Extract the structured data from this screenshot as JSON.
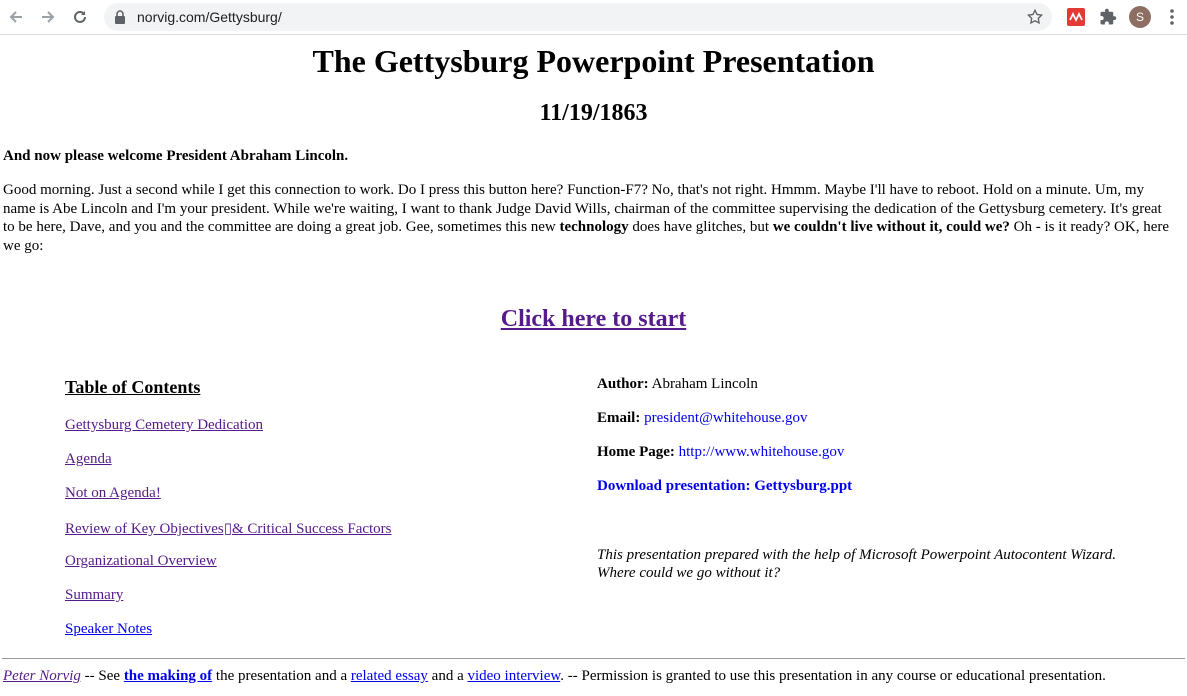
{
  "browser": {
    "url": "norvig.com/Gettysburg/",
    "avatar_letter": "S",
    "colors": {
      "omnibox_bg": "#f1f3f4",
      "ext_icon": "#e53935",
      "avatar": "#8d6e63"
    },
    "icons": [
      "back-icon",
      "forward-icon",
      "reload-icon",
      "lock-icon",
      "star-icon",
      "extension-red-icon",
      "puzzle-icon",
      "menu-dots-icon"
    ]
  },
  "page": {
    "title": "The Gettysburg Powerpoint Presentation",
    "date": "11/19/1863",
    "welcome": "And now please welcome President Abraham Lincoln.",
    "speech": {
      "part1": "Good morning. Just a second while I get this connection to work. Do I press this button here? Function-F7? No, that's not right. Hmmm. Maybe I'll have to reboot. Hold on a minute. Um, my name is Abe Lincoln and I'm your president. While we're waiting, I want to thank Judge David Wills, chairman of the committee supervising the dedication of the Gettysburg cemetery. It's great to be here, Dave, and you and the committee are doing a great job. Gee, sometimes this new ",
      "bold1": "technology",
      "part2": " does have glitches, but ",
      "bold2": "we couldn't live without it, could we?",
      "part3": " Oh - is it ready? OK, here we go:"
    },
    "start_link": "Click here to start",
    "toc": {
      "heading": "Table of Contents",
      "items": [
        "Gettysburg Cemetery Dedication",
        "Agenda",
        "Not on Agenda!",
        "Review of Key Objectives▯& Critical Success Factors",
        "Organizational Overview",
        "Summary",
        "Speaker Notes"
      ]
    },
    "meta": {
      "author_label": "Author:",
      "author": "Abraham Lincoln",
      "email_label": "Email:",
      "email": "president@whitehouse.gov",
      "homepage_label": "Home Page:",
      "homepage": "http://www.whitehouse.gov",
      "download": "Download presentation: Gettysburg.ppt"
    },
    "note": "This presentation prepared with the help of Microsoft Powerpoint Autocontent Wizard. Where could we go without it?",
    "footer": {
      "author_link": "Peter Norvig",
      "t1": " -- See ",
      "making_link": "the making of",
      "t2": " the presentation and a ",
      "essay_link": "related essay",
      "t3": " and a ",
      "video_link": "video interview",
      "t4": ". -- Permission is granted to use this presentation in any course or educational presentation."
    },
    "colors": {
      "visited_link": "#551a8b",
      "link": "#0000ee"
    }
  }
}
